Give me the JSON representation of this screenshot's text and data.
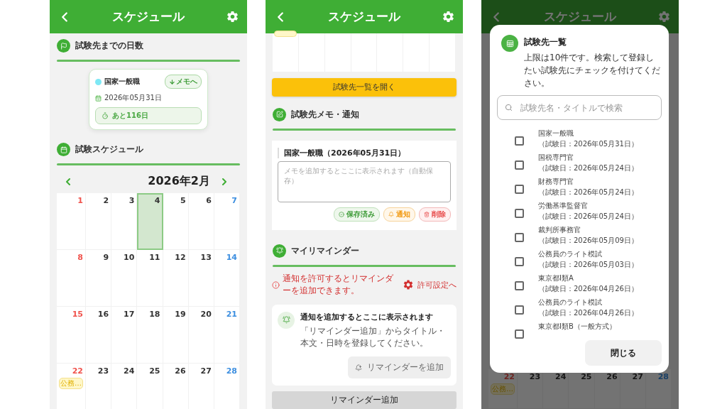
{
  "schedule_screen": {
    "header": {
      "title": "スケジュール"
    },
    "countdown_section": {
      "title": "試験先までの日数"
    },
    "countdown_card": {
      "name": "国家一般職",
      "color": "#7ee8f5",
      "memo_link": "メモへ",
      "date": "2026年05月31日",
      "remaining": "あと116日"
    },
    "calendar_section": {
      "title": "試験スケジュール"
    },
    "calendar": {
      "month": "2026年2月",
      "weeks": [
        [
          {
            "day": "1",
            "selected": false
          },
          {
            "day": "2",
            "selected": false
          },
          {
            "day": "3",
            "selected": false
          },
          {
            "day": "4",
            "selected": true
          },
          {
            "day": "5",
            "selected": false
          },
          {
            "day": "6",
            "selected": false
          },
          {
            "day": "7",
            "selected": false
          }
        ],
        [
          {
            "day": "8",
            "selected": false
          },
          {
            "day": "9",
            "selected": false
          },
          {
            "day": "10",
            "selected": false
          },
          {
            "day": "11",
            "selected": false
          },
          {
            "day": "12",
            "selected": false
          },
          {
            "day": "13",
            "selected": false
          },
          {
            "day": "14",
            "selected": false
          }
        ],
        [
          {
            "day": "15",
            "selected": false
          },
          {
            "day": "16",
            "selected": false
          },
          {
            "day": "17",
            "selected": false
          },
          {
            "day": "18",
            "selected": false
          },
          {
            "day": "19",
            "selected": false
          },
          {
            "day": "20",
            "selected": false
          },
          {
            "day": "21",
            "selected": false
          }
        ],
        [
          {
            "day": "22",
            "selected": false,
            "events": [
              "公務…"
            ]
          },
          {
            "day": "23",
            "selected": false
          },
          {
            "day": "24",
            "selected": false
          },
          {
            "day": "25",
            "selected": false
          },
          {
            "day": "26",
            "selected": false
          },
          {
            "day": "27",
            "selected": false
          },
          {
            "day": "28",
            "selected": false
          }
        ]
      ]
    }
  },
  "memo_screen": {
    "header": {
      "title": "スケジュール"
    },
    "open_list_button": "試験先一覧を開く",
    "memo_section": {
      "title": "試験先メモ・通知"
    },
    "memo_card": {
      "title": "国家一般職（2026年05月31日）",
      "placeholder": "メモを追加するとここに表示されます（自動保存）",
      "actions": [
        {
          "kind": "saved",
          "label": "保存済み"
        },
        {
          "kind": "notify",
          "label": "通知"
        },
        {
          "kind": "delete",
          "label": "削除"
        }
      ]
    },
    "reminder_section": {
      "title": "マイリマインダー"
    },
    "permission_warning": {
      "message": "通知を許可するとリマインダーを追加できます。",
      "link": "許可設定へ"
    },
    "empty_reminder": {
      "title": "通知を追加するとここに表示されます",
      "description": "「リマインダー追加」からタイトル・本文・日時を登録してください。",
      "button": {
        "label": "リマインダーを追加",
        "disabled": true
      }
    },
    "add_reminder_button": "リマインダー追加"
  },
  "exam_list_screen": {
    "background": {
      "header": {
        "title": "スケジュール"
      },
      "week": [
        {
          "day": "22",
          "events": [
            "公務…"
          ]
        },
        {
          "day": "23"
        },
        {
          "day": "24"
        },
        {
          "day": "25"
        },
        {
          "day": "26"
        },
        {
          "day": "27"
        },
        {
          "day": "28"
        }
      ]
    },
    "dialog": {
      "title": "試験先一覧",
      "description": "上限は10件です。検索して登録したい試験先にチェックを付けてください。",
      "search": {
        "placeholder": "試験先名・タイトルで検索"
      },
      "items": [
        {
          "name": "国家一般職",
          "date": "（試験日：2026年05月31日）",
          "checked": false
        },
        {
          "name": "国税専門官",
          "date": "（試験日：2026年05月24日）",
          "checked": false
        },
        {
          "name": "財務専門官",
          "date": "（試験日：2026年05月24日）",
          "checked": false
        },
        {
          "name": "労働基準監督官",
          "date": "（試験日：2026年05月24日）",
          "checked": false
        },
        {
          "name": "裁判所事務官",
          "date": "（試験日：2026年05月09日）",
          "checked": false
        },
        {
          "name": "公務員のライト模試",
          "date": "（試験日：2026年05月03日）",
          "checked": false
        },
        {
          "name": "東京都Ⅰ類A",
          "date": "（試験日：2026年04月26日）",
          "checked": false
        },
        {
          "name": "公務員のライト模試",
          "date": "（試験日：2026年04月26日）",
          "checked": false
        },
        {
          "name": "東京都Ⅰ類B（一般方式）",
          "checked": false
        }
      ],
      "close_button": "閉じる"
    }
  }
}
